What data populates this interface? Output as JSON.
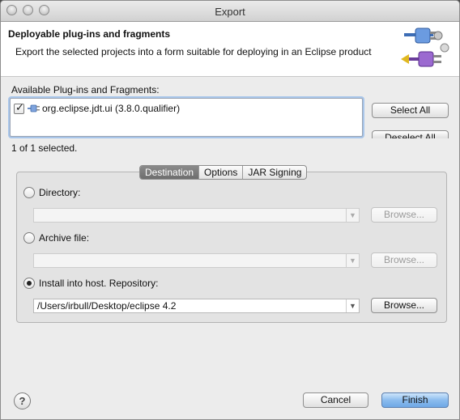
{
  "window": {
    "title": "Export"
  },
  "header": {
    "title": "Deployable plug-ins and fragments",
    "description": "Export the selected projects into a form suitable for deploying in an Eclipse product",
    "banner_icon": "plugin-export-banner-icon"
  },
  "available": {
    "label": "Available Plug-ins and Fragments:",
    "items": [
      {
        "label": "org.eclipse.jdt.ui (3.8.0.qualifier)",
        "checked": true,
        "icon": "plugin-icon"
      }
    ],
    "select_all_label": "Select All",
    "deselect_all_label": "Deselect All",
    "selected_count_text": "1 of 1 selected."
  },
  "tabs": [
    {
      "label": "Destination",
      "active": true
    },
    {
      "label": "Options",
      "active": false
    },
    {
      "label": "JAR Signing",
      "active": false
    }
  ],
  "destination": {
    "directory": {
      "label": "Directory:",
      "selected": false,
      "value": "",
      "browse_label": "Browse..."
    },
    "archive": {
      "label": "Archive file:",
      "selected": false,
      "value": "",
      "browse_label": "Browse..."
    },
    "install": {
      "label": "Install into host. Repository:",
      "selected": true,
      "value": "/Users/irbull/Desktop/eclipse 4.2",
      "browse_label": "Browse..."
    }
  },
  "footer": {
    "help_icon": "help-icon",
    "cancel_label": "Cancel",
    "finish_label": "Finish"
  },
  "colors": {
    "primary_button": "#7fb3ea",
    "focus_ring": "#a9c6ea"
  }
}
